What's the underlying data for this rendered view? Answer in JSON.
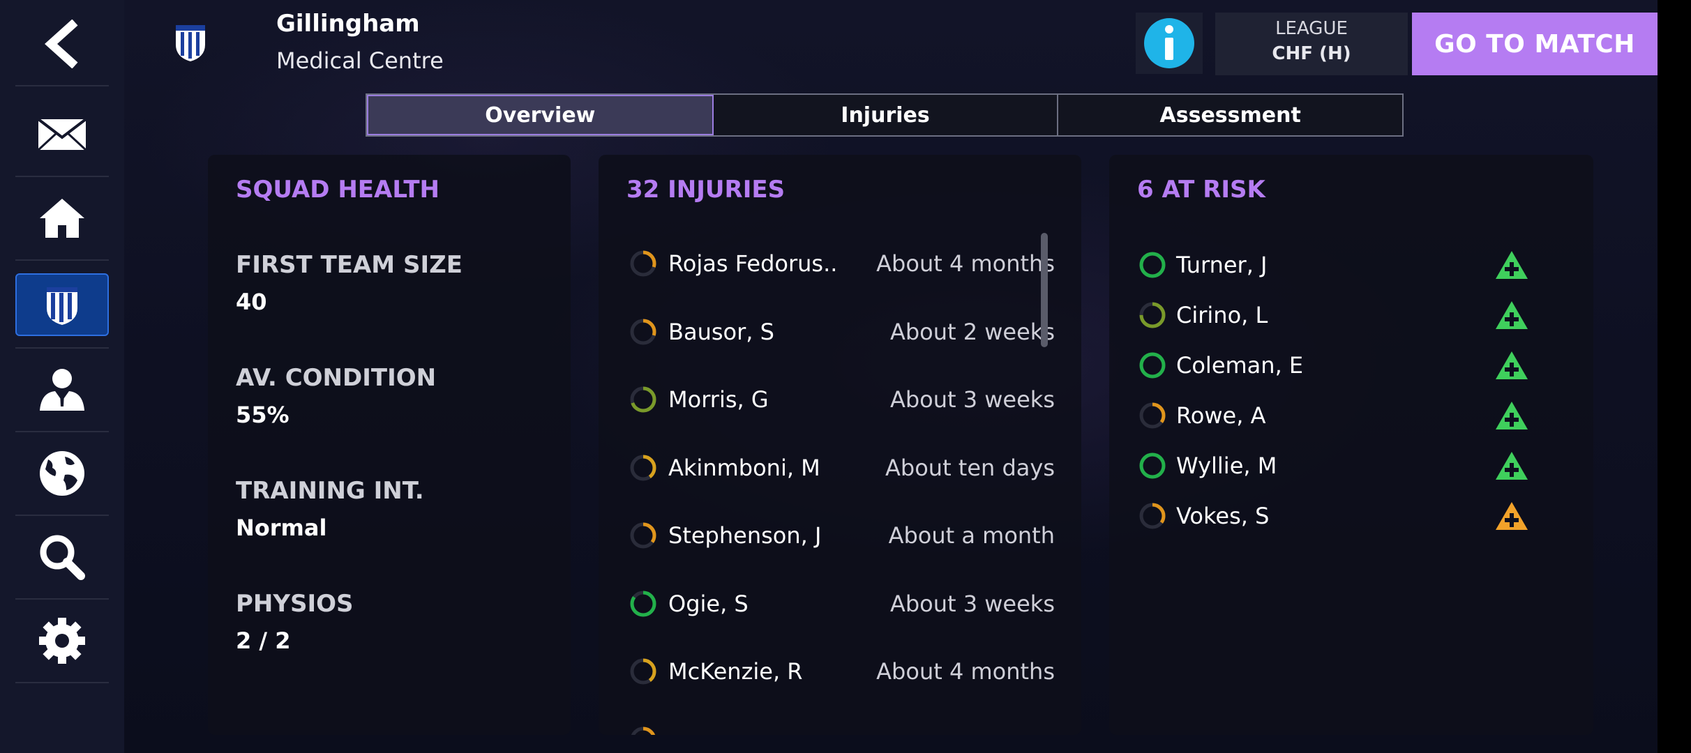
{
  "header": {
    "club_name": "Gillingham",
    "page_name": "Medical Centre",
    "next_match": {
      "label": "LEAGUE",
      "value": "CHF (H)"
    },
    "go_button": "GO TO MATCH"
  },
  "sidebar": {
    "items": [
      {
        "icon": "back-arrow-icon"
      },
      {
        "icon": "mail-icon"
      },
      {
        "icon": "home-icon"
      },
      {
        "icon": "club-crest-icon",
        "active": true
      },
      {
        "icon": "manager-icon"
      },
      {
        "icon": "globe-icon"
      },
      {
        "icon": "search-icon"
      },
      {
        "icon": "gear-icon"
      }
    ]
  },
  "tabs": [
    {
      "label": "Overview",
      "active": true
    },
    {
      "label": "Injuries",
      "active": false
    },
    {
      "label": "Assessment",
      "active": false
    }
  ],
  "squad_health": {
    "title": "SQUAD HEALTH",
    "stats": [
      {
        "label": "FIRST TEAM SIZE",
        "value": "40"
      },
      {
        "label": "AV. CONDITION",
        "value": "55%"
      },
      {
        "label": "TRAINING INT.",
        "value": "Normal"
      },
      {
        "label": "PHYSIOS",
        "value": "2 / 2"
      }
    ]
  },
  "injuries": {
    "title": "32 INJURIES",
    "rows": [
      {
        "name": "Rojas Fedorus..",
        "duration": "About 4 months",
        "status": "orange",
        "fill": 0.3
      },
      {
        "name": "Bausor, S",
        "duration": "About 2 weeks",
        "status": "orange",
        "fill": 0.3
      },
      {
        "name": "Morris, G",
        "duration": "About 3 weeks",
        "status": "olive",
        "fill": 0.7
      },
      {
        "name": "Akinmboni, M",
        "duration": "About ten days",
        "status": "yellow",
        "fill": 0.4
      },
      {
        "name": "Stephenson, J",
        "duration": "About a month",
        "status": "orange",
        "fill": 0.35
      },
      {
        "name": "Ogie, S",
        "duration": "About 3 weeks",
        "status": "green",
        "fill": 0.85
      },
      {
        "name": "McKenzie, R",
        "duration": "About 4 months",
        "status": "yellow",
        "fill": 0.4
      }
    ]
  },
  "at_risk": {
    "title": "6 AT RISK",
    "rows": [
      {
        "name": "Turner, J",
        "status": "green",
        "fill": 1.0,
        "risk": "green"
      },
      {
        "name": "Cirino, L",
        "status": "olive",
        "fill": 0.75,
        "risk": "green"
      },
      {
        "name": "Coleman, E",
        "status": "green",
        "fill": 1.0,
        "risk": "green"
      },
      {
        "name": "Rowe, A",
        "status": "orange",
        "fill": 0.35,
        "risk": "green"
      },
      {
        "name": "Wyllie, M",
        "status": "green",
        "fill": 1.0,
        "risk": "green"
      },
      {
        "name": "Vokes, S",
        "status": "orange",
        "fill": 0.35,
        "risk": "orange"
      }
    ]
  },
  "colors": {
    "accent": "#b57cf2",
    "green": "#22b04a",
    "olive": "#7a9a2a",
    "yellow": "#d8a21e",
    "orange": "#e0951c",
    "risk_green": "#3fcf5c",
    "risk_orange": "#f2a22a"
  }
}
